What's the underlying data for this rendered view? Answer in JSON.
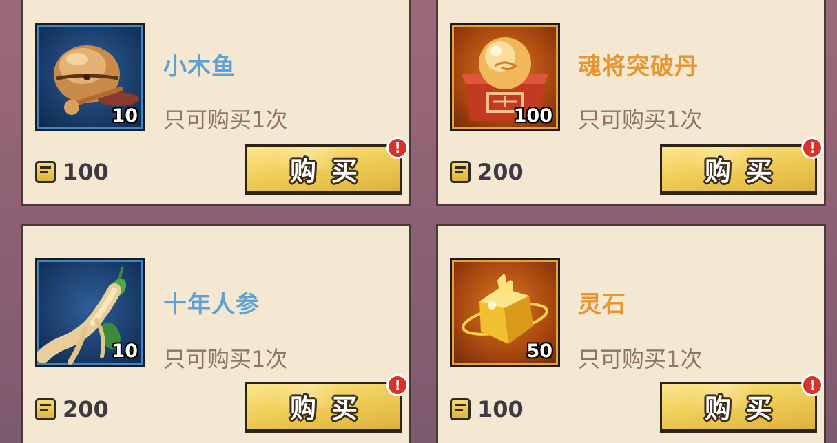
{
  "currency_icon": "ticket-coin-icon",
  "alert_glyph": "!",
  "colors": {
    "rare_blue": "#5ea2d4",
    "epic_orange": "#e69530",
    "card_bg": "#f4e8d3",
    "button_gold": "#f3d463",
    "alert_red": "#d9322b"
  },
  "items": [
    {
      "name": "小木鱼",
      "rarity": "blue",
      "icon": "wooden-fish-icon",
      "quantity": "10",
      "limit": "只可购买1次",
      "price": "100",
      "buy_label": "购买"
    },
    {
      "name": "魂将突破丹",
      "rarity": "orange",
      "icon": "breakthrough-pill-icon",
      "quantity": "100",
      "limit": "只可购买1次",
      "price": "200",
      "buy_label": "购买"
    },
    {
      "name": "十年人参",
      "rarity": "blue",
      "icon": "ginseng-icon",
      "quantity": "10",
      "limit": "只可购买1次",
      "price": "200",
      "buy_label": "购买"
    },
    {
      "name": "灵石",
      "rarity": "orange",
      "icon": "spirit-stone-icon",
      "quantity": "50",
      "limit": "只可购买1次",
      "price": "100",
      "buy_label": "购买"
    }
  ]
}
